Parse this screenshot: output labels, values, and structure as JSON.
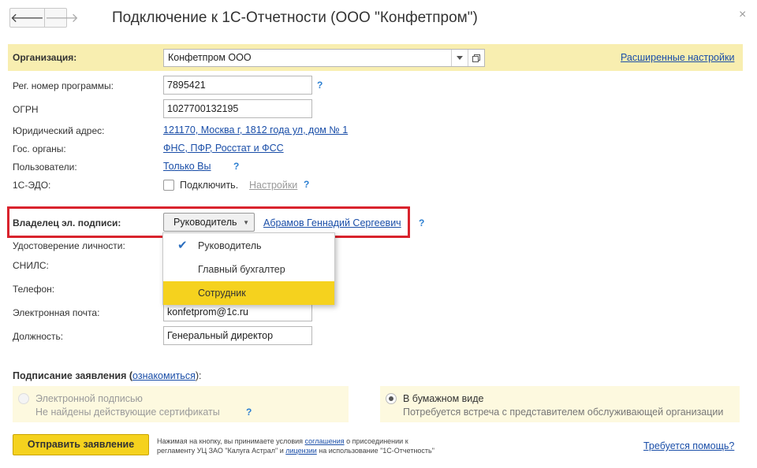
{
  "window": {
    "title": "Подключение к 1С-Отчетности (ООО \"Конфетпром\")",
    "close_glyph": "×"
  },
  "nav": {
    "back_glyph": "🡐",
    "forward_glyph": "🡒"
  },
  "org": {
    "label": "Организация:",
    "value": "Конфетпром ООО",
    "advanced_link": "Расширенные настройки"
  },
  "fields": {
    "reg_number": {
      "label": "Рег. номер программы:",
      "value": "7895421"
    },
    "ogrn": {
      "label": "ОГРН",
      "value": "1027700132195"
    },
    "address": {
      "label": "Юридический адрес:",
      "value": "121170, Москва г, 1812 года ул, дом № 1"
    },
    "gov": {
      "label": "Гос. органы:",
      "value": "ФНС, ПФР, Росстат и ФСС"
    },
    "users": {
      "label": "Пользователи:",
      "value": "Только Вы"
    },
    "edo": {
      "label": "1С-ЭДО:",
      "checkbox_label": "Подключить.",
      "settings_link": "Настройки"
    },
    "help_glyph": "?"
  },
  "signer": {
    "label": "Владелец эл. подписи:",
    "role_selected": "Руководитель",
    "person_link": "Абрамов Геннадий Сергеевич"
  },
  "dropdown": {
    "options": [
      "Руководитель",
      "Главный бухгалтер",
      "Сотрудник"
    ],
    "checked": "Руководитель",
    "highlighted": "Сотрудник"
  },
  "person": {
    "id_label": "Удостоверение личности:",
    "snils_label": "СНИЛС:",
    "phone_label": "Телефон:",
    "email_label": "Электронная почта:",
    "email_value": "konfetprom@1c.ru",
    "position_label": "Должность:",
    "position_value": "Генеральный директор"
  },
  "signing": {
    "heading_pre": "Подписание заявления (",
    "heading_link": "ознакомиться",
    "heading_post": "):",
    "electronic_title": "Электронной подписью",
    "electronic_sub": "Не найдены действующие сертификаты",
    "paper_title": "В бумажном виде",
    "paper_sub": "Потребуется встреча с представителем обслуживающей организации",
    "selected": "paper"
  },
  "footer": {
    "send_button": "Отправить заявление",
    "note_l1_a": "Нажимая на кнопку, вы принимаете условия ",
    "note_l1_link": "соглашения",
    "note_l1_b": " о присоединении к",
    "note_l2_a": "регламенту УЦ ЗАО \"Калуга Астрал\" и ",
    "note_l2_link": "лицензии",
    "note_l2_b": " на использование \"1С-Отчетность\"",
    "help_link": "Требуется помощь?"
  },
  "colors": {
    "accent_yellow": "#f5d21e",
    "org_bar": "#f8eeb0",
    "highlight_red": "#d9232d",
    "link_blue": "#1a4ea8"
  }
}
